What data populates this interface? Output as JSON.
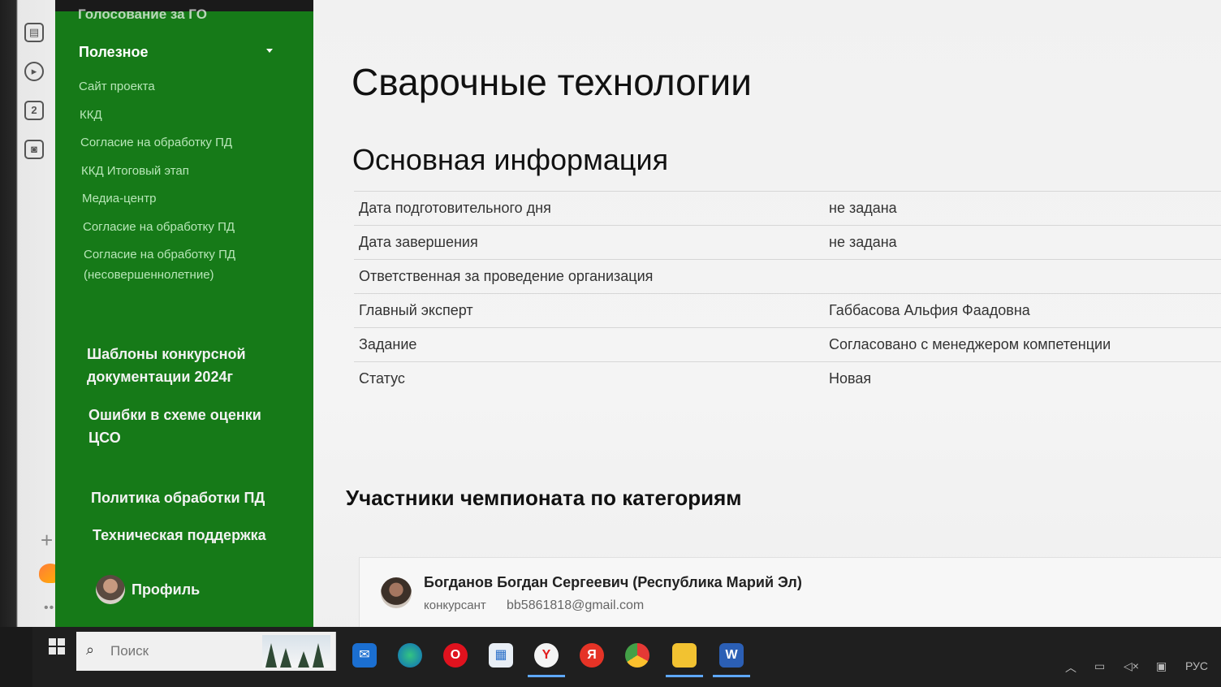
{
  "sidebar": {
    "cut_title": "Голосование за ГО",
    "section_title": "Полезное",
    "links": [
      {
        "label": "Сайт проекта"
      },
      {
        "label": "ККД"
      },
      {
        "label": "Согласие на обработку ПД"
      },
      {
        "label": "ККД Итоговый этап"
      },
      {
        "label": "Медиа-центр"
      },
      {
        "label": "Согласие на обработку ПД"
      },
      {
        "label": "Согласие на обработку ПД (несовершеннолетние)"
      }
    ],
    "big_links": [
      {
        "label": "Шаблоны конкурсной документации 2024г"
      },
      {
        "label": "Ошибки в схеме оценки ЦСО"
      },
      {
        "label": "Политика обработки ПД"
      },
      {
        "label": "Техническая поддержка"
      }
    ],
    "profile_label": "Профиль"
  },
  "rail": {
    "badge_number": "2"
  },
  "main": {
    "title": "Сварочные технологии",
    "section_title": "Основная информация",
    "info": [
      {
        "key": "Дата подготовительного дня",
        "value": "не задана"
      },
      {
        "key": "Дата завершения",
        "value": "не задана"
      },
      {
        "key": "Ответственная за проведение организация",
        "value": ""
      },
      {
        "key": "Главный эксперт",
        "value": "Габбасова Альфия Фаадовна"
      },
      {
        "key": "Задание",
        "value": "Согласовано с менеджером компетенции"
      },
      {
        "key": "Статус",
        "value": "Новая"
      }
    ],
    "participants_title": "Участники чемпионата по категориям",
    "participant": {
      "name": "Богданов Богдан Сергеевич (Республика Марий Эл)",
      "role": "конкурсант",
      "email": "bb5861818@gmail.com"
    }
  },
  "taskbar": {
    "search_placeholder": "Поиск",
    "yandex_letter": "Я",
    "word_letter": "W",
    "language": "РУС"
  }
}
